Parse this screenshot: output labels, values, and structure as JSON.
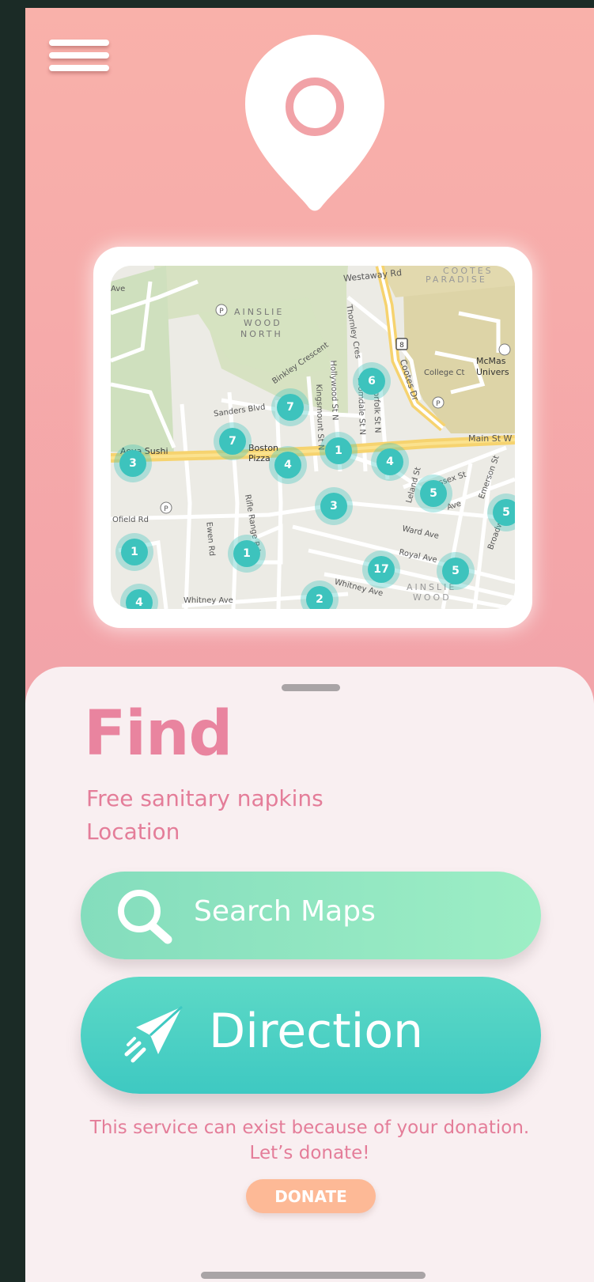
{
  "colors": {
    "header_top": "#f9b1aa",
    "header_bottom": "#e898ae",
    "accent_pink": "#e9849f",
    "search_button": "#9deec5",
    "direction_button": "#3ec9c2",
    "donate_button": "#fdb996",
    "sheet_background": "#f9eff1",
    "cluster_marker": "#3dc3bd"
  },
  "header": {
    "menu_icon": "hamburger-menu-icon",
    "logo_icon": "location-pin-icon"
  },
  "map": {
    "street_labels": [
      "Westaway Rd",
      "Thornley Cres",
      "Binkley Crescent",
      "Sanders Blvd",
      "Hollywood St N",
      "Dromdale St N",
      "Kingsmount St N",
      "Norfolk St N",
      "Cootes Dr",
      "College Ct",
      "Main St W",
      "Sussex St",
      "Leland St",
      "Emerson St",
      "Ofield Rd",
      "Ewen Rd",
      "Rifle Range Rd",
      "Ward Ave",
      "Royal Ave",
      "Broadway",
      "Whitney Ave",
      "Whitney Ave",
      "Ave",
      "Ave"
    ],
    "area_labels": [
      "AINSLIE",
      "WOOD",
      "NORTH",
      "COOTES",
      "PARADISE",
      "AINSLIE",
      "WOOD",
      "McMas",
      "Univers"
    ],
    "poi_labels": [
      "Boston Pizza",
      "Aoya Sushi"
    ],
    "clusters": [
      "3",
      "7",
      "7",
      "4",
      "1",
      "6",
      "4",
      "5",
      "5",
      "3",
      "1",
      "1",
      "4",
      "2",
      "17",
      "5"
    ]
  },
  "sheet": {
    "title": "Find",
    "subtitle_line1": "Free sanitary napkins",
    "subtitle_line2": "Location",
    "search_button": {
      "icon": "search-icon",
      "label": "Search Maps"
    },
    "direction_button": {
      "icon": "paper-plane-icon",
      "label": "Direction"
    },
    "donation_line1": "This service can exist because of your donation.",
    "donation_line2": "Let’s donate!",
    "donate_label": "DONATE"
  }
}
